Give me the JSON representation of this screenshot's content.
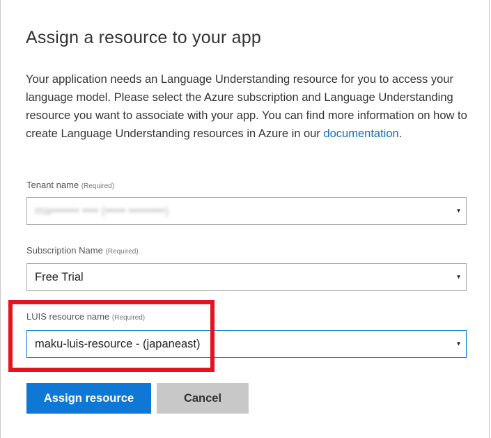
{
  "dialog": {
    "title": "Assign a resource to your app",
    "description": "Your application needs an Language Understanding resource for you to access your language model. Please select the Azure subscription and Language Understanding resource you want to associate with your app. You can find more information on how to create Language Understanding resources in Azure in our ",
    "description_link": "documentation",
    "description_end": "."
  },
  "fields": {
    "tenant": {
      "label": "Tenant name",
      "required": "(Required)",
      "value": "ma••••••• •••• (••••• •••••••••)"
    },
    "subscription": {
      "label": "Subscription Name",
      "required": "(Required)",
      "value": "Free Trial"
    },
    "luis_resource": {
      "label": "LUIS resource name",
      "required": "(Required)",
      "value": "maku-luis-resource - (japaneast)"
    }
  },
  "buttons": {
    "assign": "Assign resource",
    "cancel": "Cancel"
  },
  "icons": {
    "dropdown": "▾"
  },
  "colors": {
    "primary": "#0f78d4",
    "highlight": "#e3141f",
    "link": "#0f6cbd"
  }
}
